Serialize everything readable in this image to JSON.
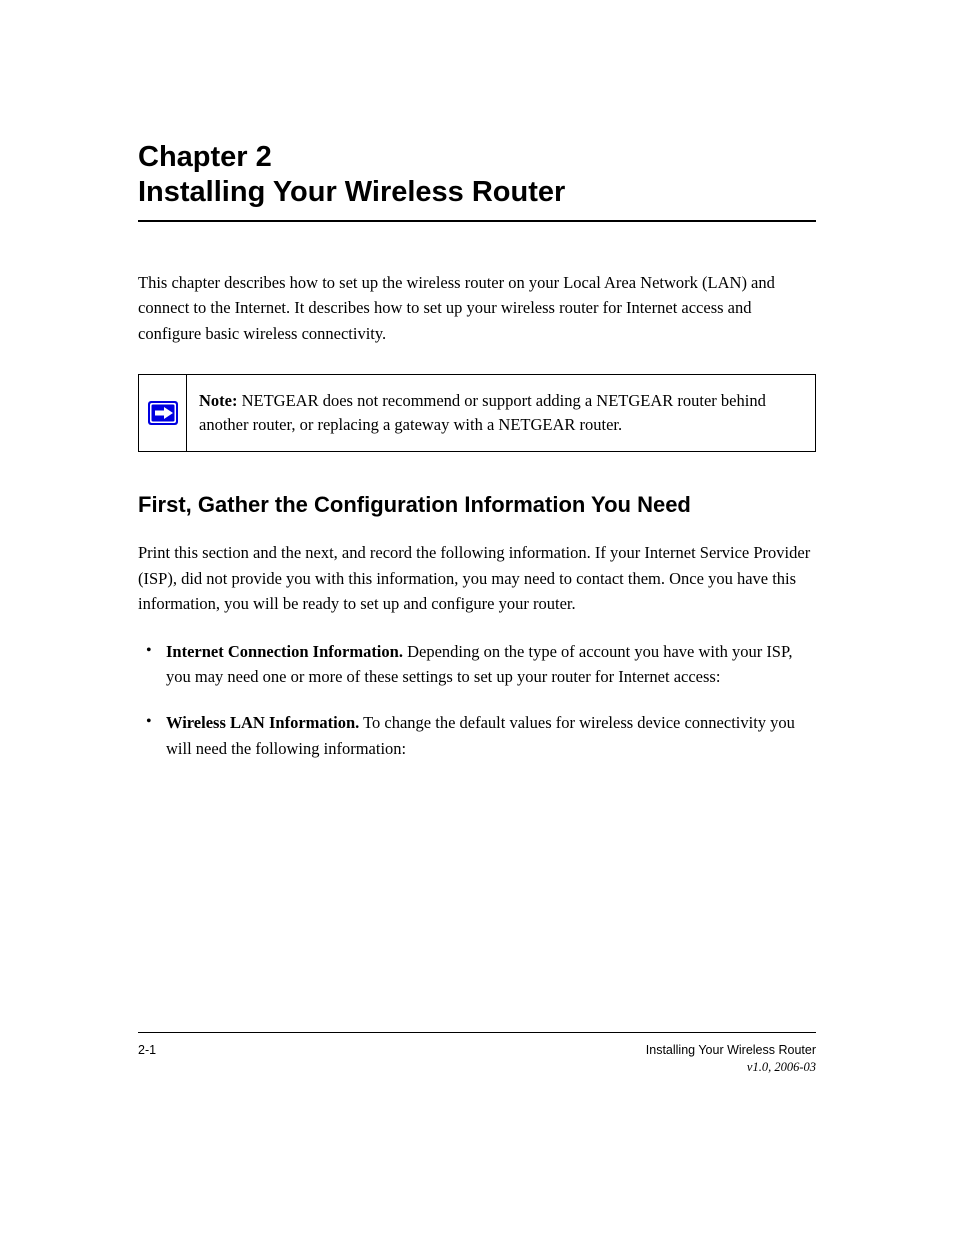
{
  "chapter": {
    "title_line1": "Chapter 2",
    "title_line2": "Installing Your Wireless Router"
  },
  "intro": "This chapter describes how to set up the wireless router on your Local Area Network (LAN) and connect to the Internet. It describes how to set up your wireless router for Internet access and configure basic wireless connectivity.",
  "note": {
    "label": "Note:",
    "text": " NETGEAR does not recommend or support adding a NETGEAR router behind another router, or replacing a gateway with a NETGEAR router."
  },
  "section": {
    "heading": "First, Gather the Configuration Information You Need",
    "para": "Print this section and the next, and record the following information. If your Internet Service Provider (ISP), did not provide you with this information, you may need to contact them. Once you have this information, you will be ready to set up and configure your router.",
    "bullets": [
      {
        "title": "Internet Connection Information.",
        "body": " Depending on the type of account you have with your ISP, you may need one or more of these settings to set up your router for Internet access:"
      },
      {
        "title": "Wireless LAN Information.",
        "body": " To change the default values for wireless device connectivity you will need the following information:"
      }
    ]
  },
  "footer": {
    "left": "2-1",
    "right": "Installing Your Wireless Router",
    "version": "v1.0, 2006-03"
  }
}
